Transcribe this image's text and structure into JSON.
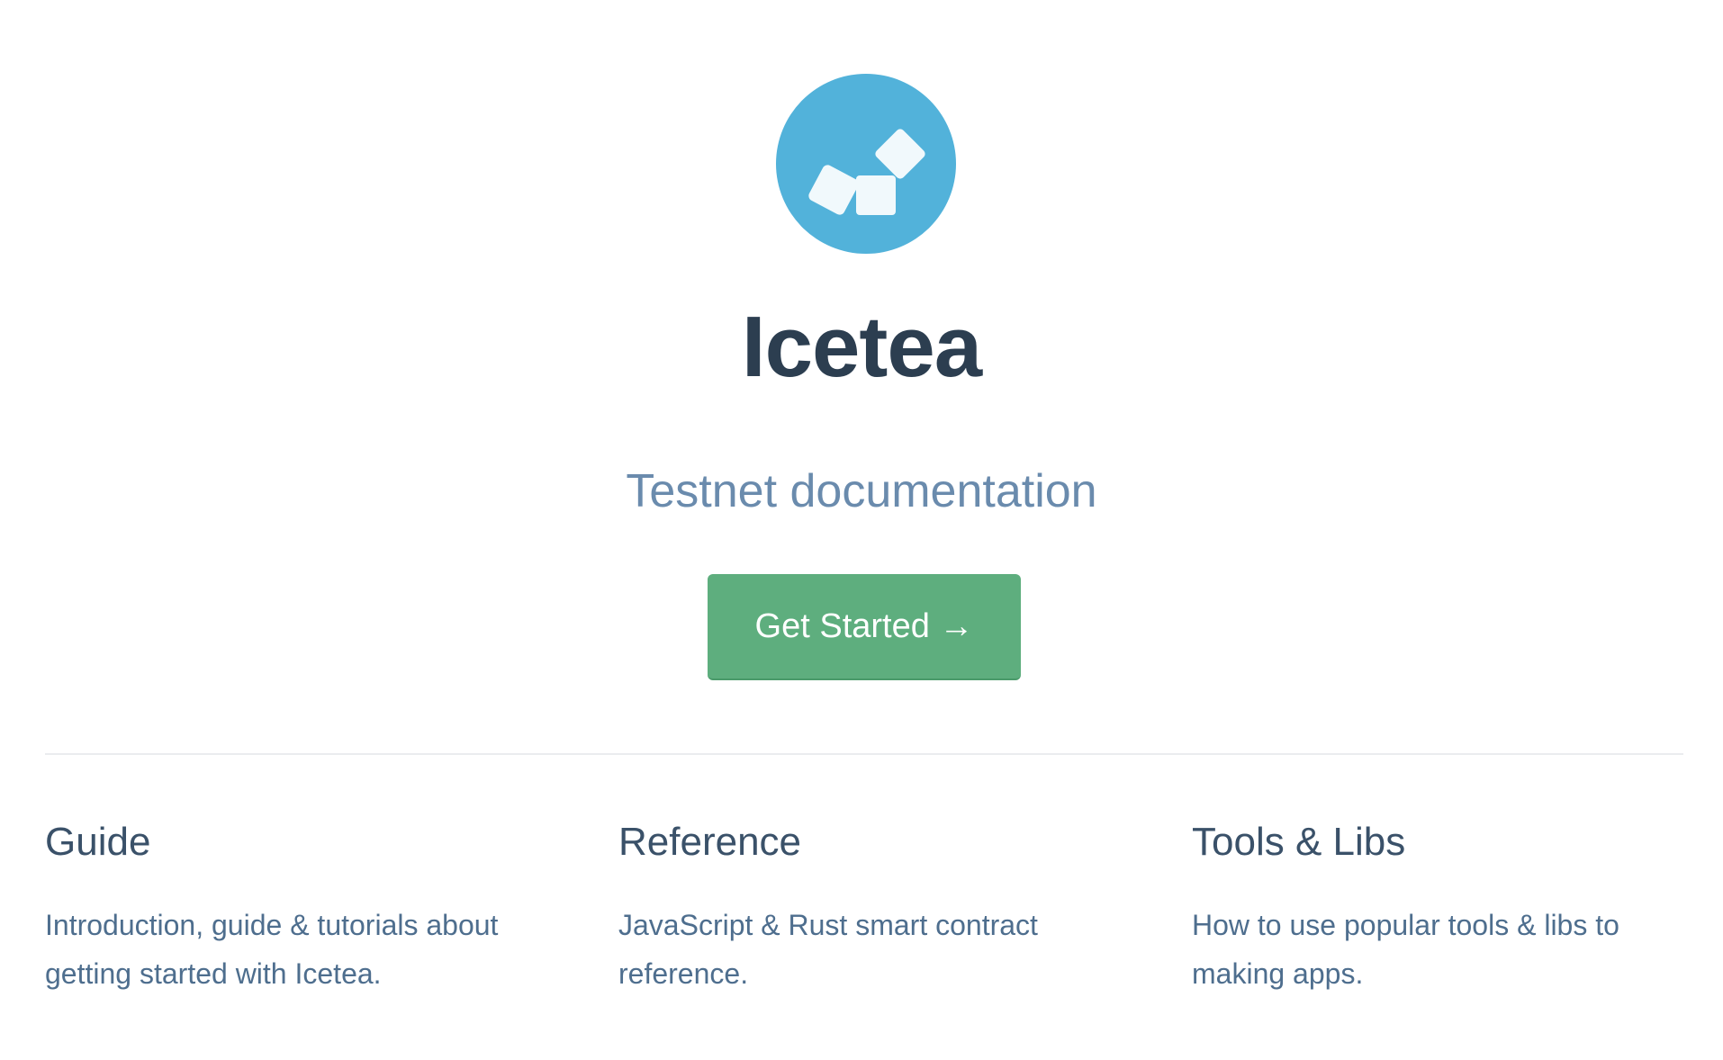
{
  "hero": {
    "logo_icon": "ice-cubes-logo-icon",
    "logo_color": "#52b2da",
    "title": "Icetea",
    "subtitle": "Testnet documentation",
    "cta_label": "Get Started →"
  },
  "features": [
    {
      "title": "Guide",
      "description": "Introduction, guide & tutorials about getting started with Icetea."
    },
    {
      "title": "Reference",
      "description": "JavaScript & Rust smart contract reference."
    },
    {
      "title": "Tools & Libs",
      "description": "How to use popular tools & libs to making apps."
    }
  ]
}
